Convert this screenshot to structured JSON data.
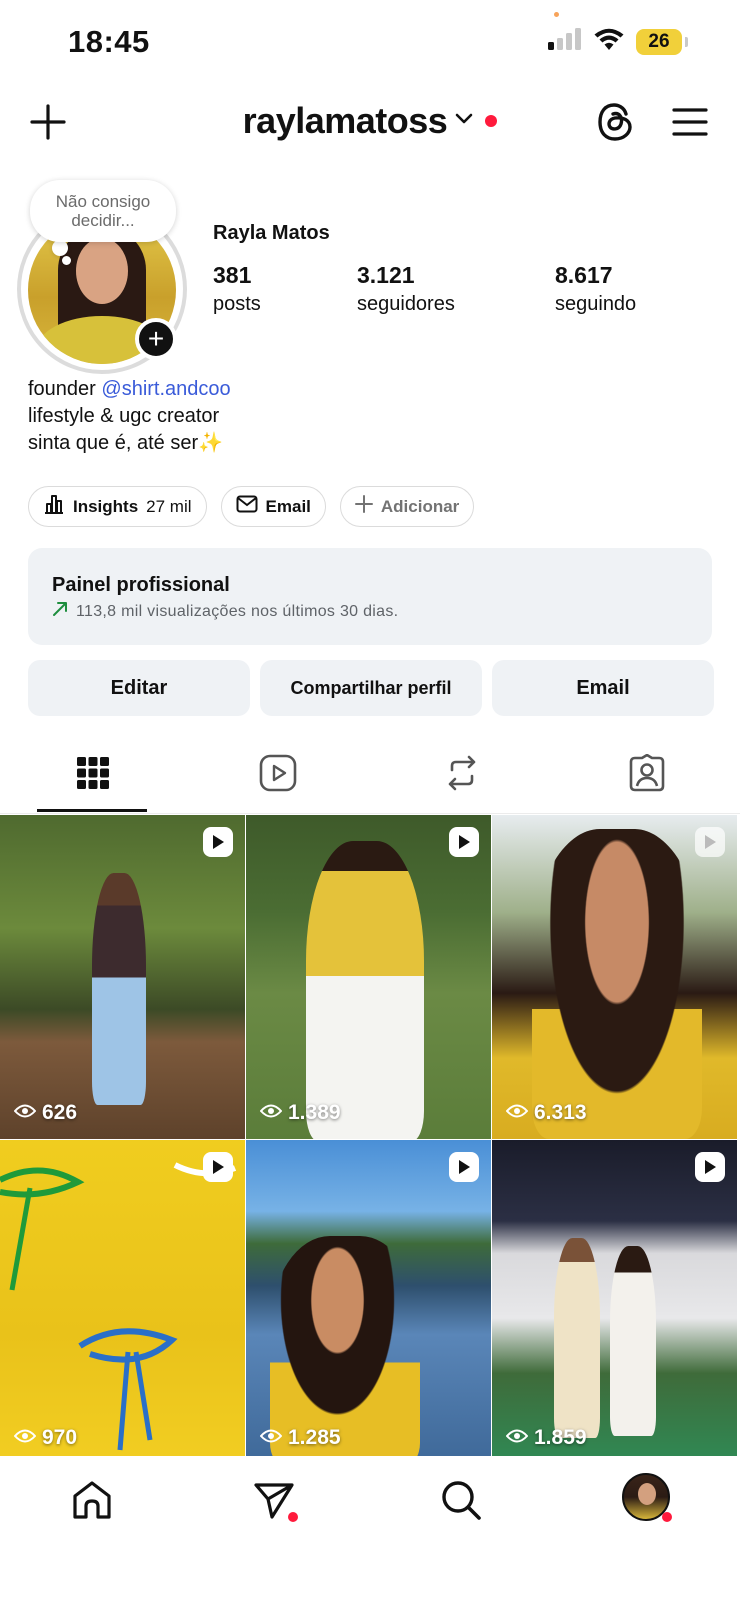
{
  "status_bar": {
    "time": "18:45",
    "battery": "26"
  },
  "header": {
    "username": "raylamatoss"
  },
  "profile": {
    "note": "Não consigo decidir...",
    "display_name": "Rayla Matos",
    "stats": [
      {
        "value": "381",
        "label": "posts"
      },
      {
        "value": "3.121",
        "label": "seguidores"
      },
      {
        "value": "8.617",
        "label": "seguindo"
      }
    ],
    "bio": {
      "line1_prefix": "founder",
      "mention": "@shirt.andcoo",
      "line2": "lifestyle & ugc creator",
      "line3": "sinta que é, até ser✨"
    },
    "chips": {
      "insights_label": "Insights",
      "insights_value": "27 mil",
      "email_label": "Email",
      "add_label": "Adicionar"
    },
    "panel": {
      "title": "Painel profissional",
      "subtitle": "113,8 mil visualizações nos últimos 30 dias."
    },
    "actions": {
      "edit": "Editar",
      "share": "Compartilhar perfil",
      "email": "Email"
    }
  },
  "grid": [
    {
      "views": "626"
    },
    {
      "views": "1.389"
    },
    {
      "views": "6.313"
    },
    {
      "views": "970"
    },
    {
      "views": "1.285"
    },
    {
      "views": "1.859"
    }
  ],
  "icons": {
    "header": [
      "plus-icon",
      "chevron-down-icon",
      "threads-icon",
      "menu-icon"
    ],
    "tabs": [
      "grid-icon",
      "reels-icon",
      "reposts-icon",
      "tagged-icon"
    ],
    "nav": [
      "home-icon",
      "send-icon",
      "search-icon",
      "profile-avatar"
    ]
  },
  "colors": {
    "accent_red": "#ff1a3c",
    "mention_blue": "#3a5bd9",
    "panel_bg": "#eff2f5"
  }
}
